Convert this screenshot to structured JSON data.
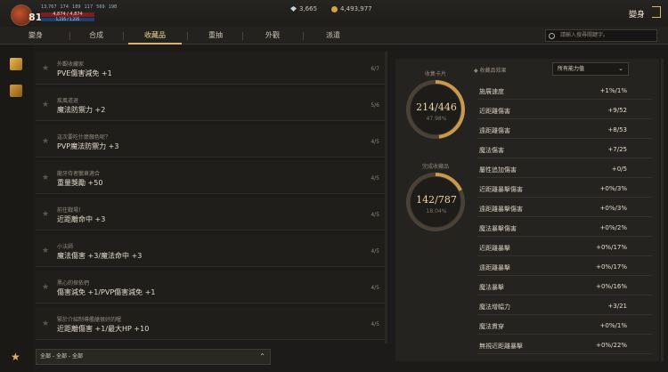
{
  "header": {
    "level": "81",
    "stats": [
      "13,767",
      "174",
      "189",
      "117",
      "569",
      "198"
    ],
    "hp": "4,874 / 4,874",
    "mp": "1,235 / 1,235",
    "diamonds": "3,665",
    "gold": "4,493,977",
    "title": "變身"
  },
  "tabs": [
    "變身",
    "合成",
    "收藏品",
    "重抽",
    "外觀",
    "派遣"
  ],
  "active_tab": "收藏品",
  "search": {
    "placeholder": "請輸入搜尋關鍵字。"
  },
  "collections": [
    {
      "name": "外觀收藏家",
      "effect": "PVE傷害減免 +1",
      "count": "6/7"
    },
    {
      "name": "疾風道退",
      "effect": "魔法防禦力 +2",
      "count": "5/6"
    },
    {
      "name": "這次要吃什麼顏色呢？",
      "effect": "PVP魔法防禦力 +3",
      "count": "4/5"
    },
    {
      "name": "龍牙侍者徽章適合",
      "effect": "重量獎勵 +50",
      "count": "4/5"
    },
    {
      "name": "前往戰場！",
      "effect": "近距離命中 +3",
      "count": "4/5"
    },
    {
      "name": "小法師",
      "effect": "魔法傷害 +3/魔法命中 +3",
      "count": "4/5"
    },
    {
      "name": "黑心的探依們",
      "effect": "傷害減免 +1/PVP傷害減免 +1",
      "count": "4/5"
    },
    {
      "name": "緊於介紹制導艦艙很好的喔",
      "effect": "近距離傷害 +1/最大HP +10",
      "count": "4/5"
    }
  ],
  "filter": {
    "label": "全部 - 全部 - 全部"
  },
  "summary": {
    "cards_label": "收集卡片",
    "cards_value": "214/446",
    "cards_pct": "47.98%",
    "cards_fraction": 0.4798,
    "done_label": "完成收藏品",
    "done_value": "142/787",
    "done_pct": "18.04%",
    "done_fraction": 0.1804,
    "effects_title": "收藏品效果",
    "dropdown": "所有能力值"
  },
  "effects": [
    {
      "label": "施展速度",
      "value": "+1%/1%"
    },
    {
      "label": "近距離傷害",
      "value": "+9/52"
    },
    {
      "label": "遠距離傷害",
      "value": "+8/53"
    },
    {
      "label": "魔法傷害",
      "value": "+7/25"
    },
    {
      "label": "屬性追加傷害",
      "value": "+0/5"
    },
    {
      "label": "近距離暴擊傷害",
      "value": "+0%/3%"
    },
    {
      "label": "遠距離暴擊傷害",
      "value": "+0%/3%"
    },
    {
      "label": "魔法暴擊傷害",
      "value": "+0%/2%"
    },
    {
      "label": "近距離暴擊",
      "value": "+0%/17%"
    },
    {
      "label": "遠距離暴擊",
      "value": "+0%/17%"
    },
    {
      "label": "魔法暴擊",
      "value": "+0%/16%"
    },
    {
      "label": "魔法增幅力",
      "value": "+3/21"
    },
    {
      "label": "魔法貫穿",
      "value": "+0%/1%"
    },
    {
      "label": "無視近距離暴擊",
      "value": "+0%/22%"
    }
  ]
}
